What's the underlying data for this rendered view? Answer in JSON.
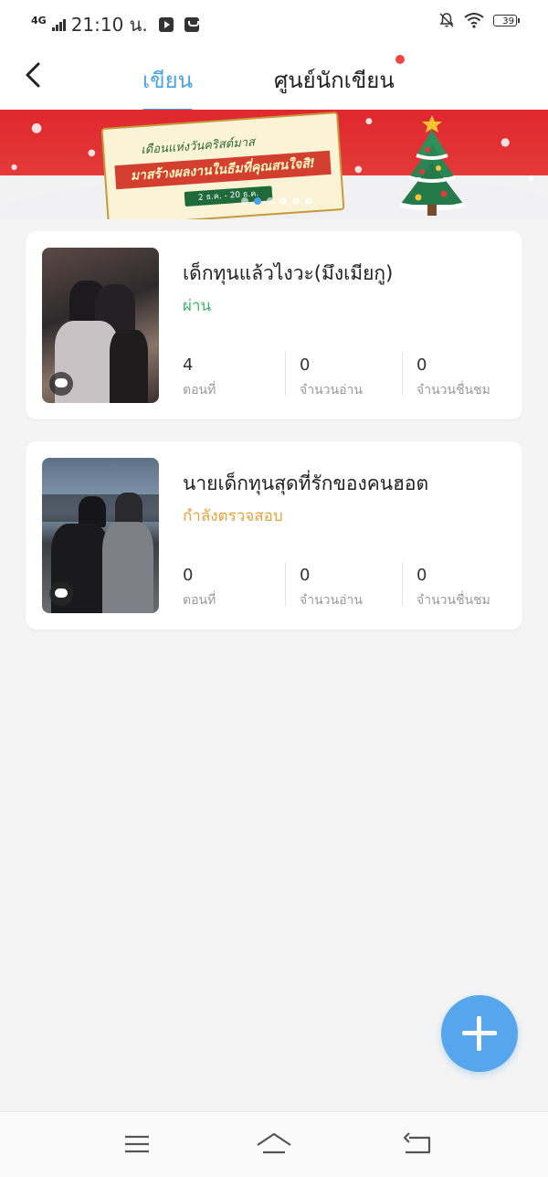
{
  "status_bar": {
    "network": "4G",
    "time": "21:10 น.",
    "battery": "39"
  },
  "header": {
    "tabs": [
      {
        "label": "เขียน",
        "active": true
      },
      {
        "label": "ศูนย์นักเขียน",
        "active": false,
        "notification_dot": true
      }
    ]
  },
  "banner": {
    "title": "เดือนแห่งวันคริสต์มาส",
    "headline": "มาสร้างผลงานในธีมที่คุณสนใจสิ!",
    "date": "2 ธ.ค. - 20 ธ.ค.",
    "slide_count": 6,
    "active_slide": 1
  },
  "stories": [
    {
      "title": "เด็กทุนแล้วไงวะ(มึงเมียกู)",
      "status": "ผ่าน",
      "stats": [
        {
          "value": "4",
          "label": "ตอนที่"
        },
        {
          "value": "0",
          "label": "จำนวนอ่าน"
        },
        {
          "value": "0",
          "label": "จำนวนชื่นชม"
        }
      ]
    },
    {
      "title": "นายเด็กทุนสุดที่รักของคนฮอต",
      "status": "กำลังตรวจสอบ",
      "stats": [
        {
          "value": "0",
          "label": "ตอนที่"
        },
        {
          "value": "0",
          "label": "จำนวนอ่าน"
        },
        {
          "value": "0",
          "label": "จำนวนชื่นชม"
        }
      ]
    }
  ],
  "fab": {
    "icon": "plus-icon"
  },
  "navbar": {
    "icons": [
      "menu-icon",
      "home-icon",
      "back-icon"
    ]
  },
  "colors": {
    "accent": "#4aa3e8",
    "pass": "#3bb56b",
    "review": "#e6a23c",
    "fab": "#55a6ec",
    "banner_red": "#e0272e"
  }
}
